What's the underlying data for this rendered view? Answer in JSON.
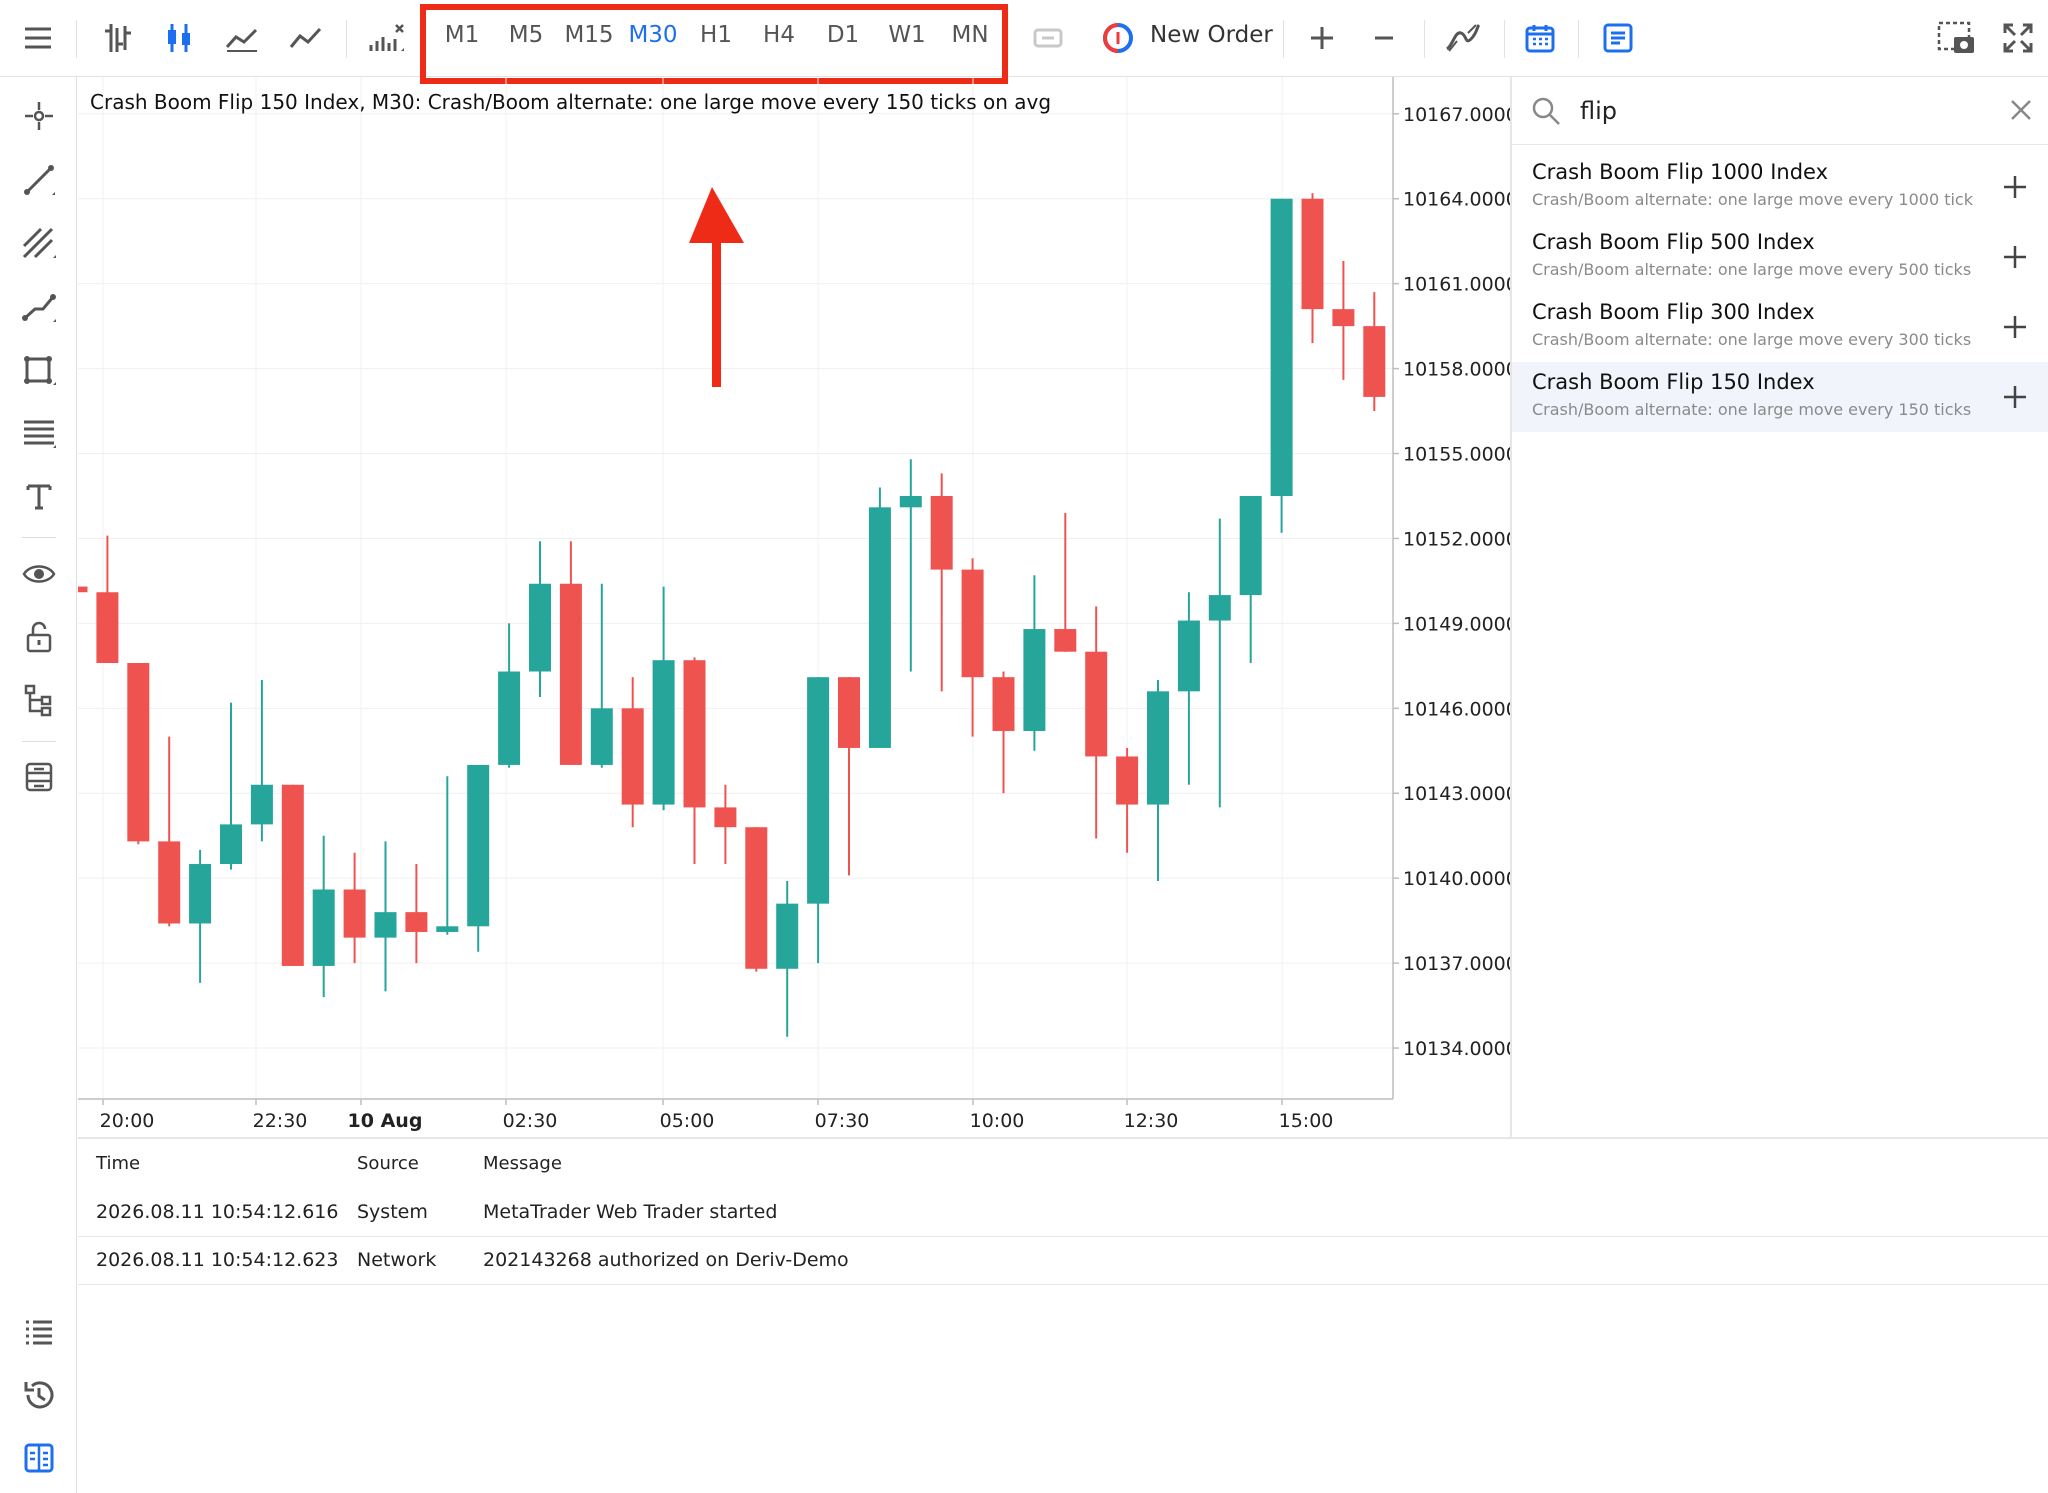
{
  "toolbar": {
    "timeframes": [
      "M1",
      "M5",
      "M15",
      "M30",
      "H1",
      "H4",
      "D1",
      "W1",
      "MN"
    ],
    "active_timeframe": "M30",
    "new_order_label": "New Order"
  },
  "chart": {
    "title": "Crash Boom Flip 150 Index, M30: Crash/Boom alternate: one large move every 150 ticks on avg",
    "colors": {
      "bull": "#26a69a",
      "bear": "#ef5350",
      "grid": "#f0f0f0",
      "annotation": "#ee2b16"
    }
  },
  "chart_data": {
    "type": "candlestick",
    "ylim": [
      10132.2,
      10168.3
    ],
    "y_ticks": [
      "10167.0000",
      "10164.0000",
      "10161.0000",
      "10158.0000",
      "10155.0000",
      "10152.0000",
      "10149.0000",
      "10146.0000",
      "10143.0000",
      "10140.0000",
      "10137.0000",
      "10134.0000"
    ],
    "x_ticks": [
      "20:00",
      "22:30",
      "10 Aug",
      "02:30",
      "05:00",
      "07:30",
      "10:00",
      "12:30",
      "15:00"
    ],
    "x_ticks_bold": [
      "10 Aug"
    ],
    "candles": [
      {
        "o": 10150.3,
        "h": 10150.3,
        "l": 10149.8,
        "c": 10150.1
      },
      {
        "o": 10150.1,
        "h": 10152.1,
        "l": 10147.7,
        "c": 10147.6
      },
      {
        "o": 10147.6,
        "h": 10147.6,
        "l": 10141.2,
        "c": 10141.3
      },
      {
        "o": 10141.3,
        "h": 10145.0,
        "l": 10138.3,
        "c": 10138.4
      },
      {
        "o": 10138.4,
        "h": 10141.0,
        "l": 10136.3,
        "c": 10140.5
      },
      {
        "o": 10140.5,
        "h": 10146.2,
        "l": 10140.3,
        "c": 10141.9
      },
      {
        "o": 10141.9,
        "h": 10147.0,
        "l": 10141.3,
        "c": 10143.3
      },
      {
        "o": 10143.3,
        "h": 10143.3,
        "l": 10137.0,
        "c": 10136.9
      },
      {
        "o": 10136.9,
        "h": 10141.5,
        "l": 10135.8,
        "c": 10139.6
      },
      {
        "o": 10139.6,
        "h": 10140.9,
        "l": 10137.0,
        "c": 10137.9
      },
      {
        "o": 10137.9,
        "h": 10141.3,
        "l": 10136.0,
        "c": 10138.8
      },
      {
        "o": 10138.8,
        "h": 10140.5,
        "l": 10137.0,
        "c": 10138.1
      },
      {
        "o": 10138.1,
        "h": 10143.6,
        "l": 10138.0,
        "c": 10138.3
      },
      {
        "o": 10138.3,
        "h": 10143.9,
        "l": 10137.4,
        "c": 10144.0
      },
      {
        "o": 10144.0,
        "h": 10149.0,
        "l": 10143.9,
        "c": 10147.3
      },
      {
        "o": 10147.3,
        "h": 10151.9,
        "l": 10146.4,
        "c": 10150.4
      },
      {
        "o": 10150.4,
        "h": 10151.9,
        "l": 10144.0,
        "c": 10144.0
      },
      {
        "o": 10144.0,
        "h": 10150.4,
        "l": 10143.9,
        "c": 10146.0
      },
      {
        "o": 10146.0,
        "h": 10147.1,
        "l": 10141.8,
        "c": 10142.6
      },
      {
        "o": 10142.6,
        "h": 10150.3,
        "l": 10142.4,
        "c": 10147.7
      },
      {
        "o": 10147.7,
        "h": 10147.8,
        "l": 10140.5,
        "c": 10142.5
      },
      {
        "o": 10142.5,
        "h": 10143.3,
        "l": 10140.5,
        "c": 10141.8
      },
      {
        "o": 10141.8,
        "h": 10141.8,
        "l": 10136.7,
        "c": 10136.8
      },
      {
        "o": 10136.8,
        "h": 10139.9,
        "l": 10134.4,
        "c": 10139.1
      },
      {
        "o": 10139.1,
        "h": 10147.1,
        "l": 10137.0,
        "c": 10147.1
      },
      {
        "o": 10147.1,
        "h": 10147.1,
        "l": 10140.1,
        "c": 10144.6
      },
      {
        "o": 10144.6,
        "h": 10153.8,
        "l": 10144.6,
        "c": 10153.1
      },
      {
        "o": 10153.1,
        "h": 10154.8,
        "l": 10147.3,
        "c": 10153.5
      },
      {
        "o": 10153.5,
        "h": 10154.3,
        "l": 10146.6,
        "c": 10150.9
      },
      {
        "o": 10150.9,
        "h": 10151.3,
        "l": 10145.0,
        "c": 10147.1
      },
      {
        "o": 10147.1,
        "h": 10147.3,
        "l": 10143.0,
        "c": 10145.2
      },
      {
        "o": 10145.2,
        "h": 10150.7,
        "l": 10144.5,
        "c": 10148.8
      },
      {
        "o": 10148.8,
        "h": 10152.9,
        "l": 10148.2,
        "c": 10148.0
      },
      {
        "o": 10148.0,
        "h": 10149.6,
        "l": 10141.4,
        "c": 10144.3
      },
      {
        "o": 10144.3,
        "h": 10144.6,
        "l": 10140.9,
        "c": 10142.6
      },
      {
        "o": 10142.6,
        "h": 10147.0,
        "l": 10139.9,
        "c": 10146.6
      },
      {
        "o": 10146.6,
        "h": 10150.1,
        "l": 10143.3,
        "c": 10149.1
      },
      {
        "o": 10149.1,
        "h": 10152.7,
        "l": 10142.5,
        "c": 10150.0
      },
      {
        "o": 10150.0,
        "h": 10153.2,
        "l": 10147.6,
        "c": 10153.5
      },
      {
        "o": 10153.5,
        "h": 10154.6,
        "l": 10152.2,
        "c": 10164.0
      },
      {
        "o": 10164.0,
        "h": 10164.2,
        "l": 10158.9,
        "c": 10160.1
      },
      {
        "o": 10160.1,
        "h": 10161.8,
        "l": 10157.6,
        "c": 10159.5
      },
      {
        "o": 10159.5,
        "h": 10160.7,
        "l": 10156.5,
        "c": 10157.0
      }
    ]
  },
  "symbol_search": {
    "query": "flip",
    "results": [
      {
        "name": "Crash Boom Flip 1000 Index",
        "desc": "Crash/Boom alternate: one large move every 1000 tick"
      },
      {
        "name": "Crash Boom Flip 500 Index",
        "desc": "Crash/Boom alternate: one large move every 500 ticks"
      },
      {
        "name": "Crash Boom Flip 300 Index",
        "desc": "Crash/Boom alternate: one large move every 300 ticks"
      },
      {
        "name": "Crash Boom Flip 150 Index",
        "desc": "Crash/Boom alternate: one large move every 150 ticks"
      }
    ]
  },
  "journal": {
    "headers": {
      "time": "Time",
      "source": "Source",
      "message": "Message"
    },
    "rows": [
      {
        "time": "2026.08.11 10:54:12.616",
        "source": "System",
        "message": "MetaTrader Web Trader started"
      },
      {
        "time": "2026.08.11 10:54:12.623",
        "source": "Network",
        "message": "202143268 authorized on Deriv-Demo"
      }
    ]
  }
}
